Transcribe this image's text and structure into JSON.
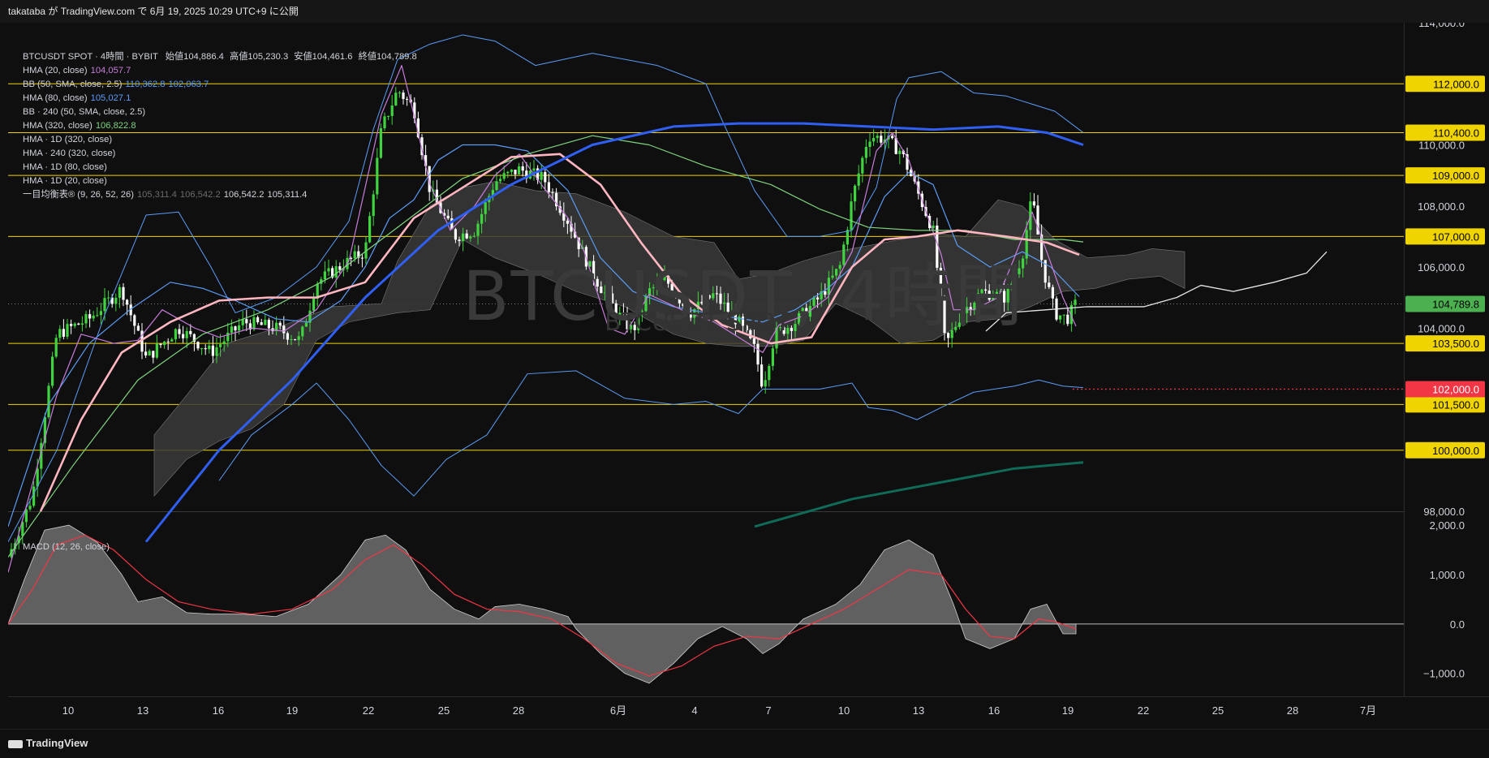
{
  "header": {
    "publish_line": "takataba が TradingView.com で 6月 19, 2025 10:29 UTC+9 に公開"
  },
  "legend": {
    "symbol_line": {
      "symbol": "BTCUSDT SPOT · 4時間 · BYBIT",
      "open_label": "始値",
      "open": "104,886.4",
      "high_label": "高値",
      "high": "105,230.3",
      "low_label": "安値",
      "low": "104,461.6",
      "close_label": "終値",
      "close": "104,789.8"
    },
    "indicators": [
      {
        "name": "HMA (20, close)",
        "values": [
          "104,057.7"
        ],
        "colors": [
          "#c77ddb"
        ]
      },
      {
        "name": "BB (50, SMA, close, 2.5)",
        "values": [
          "110,362.8",
          "102,063.7"
        ],
        "colors": [
          "#5b9cf5",
          "#5b9cf5"
        ]
      },
      {
        "name": "HMA (80, close)",
        "values": [
          "105,027.1"
        ],
        "colors": [
          "#5b9cf5"
        ]
      },
      {
        "name": "BB · 240 (50, SMA, close, 2.5)",
        "values": [],
        "colors": []
      },
      {
        "name": "HMA (320, close)",
        "values": [
          "106,822.8"
        ],
        "colors": [
          "#7fd47f"
        ]
      },
      {
        "name": "HMA · 1D (320, close)",
        "values": [],
        "colors": []
      },
      {
        "name": "HMA · 240 (320, close)",
        "values": [],
        "colors": []
      },
      {
        "name": "HMA · 1D (80, close)",
        "values": [],
        "colors": []
      },
      {
        "name": "HMA · 1D (20, close)",
        "values": [],
        "colors": []
      },
      {
        "name": "一目均衡表® (9, 26, 52, 26)",
        "values": [
          "105,311.4",
          "106,542.2",
          "106,542.2",
          "105,311.4"
        ],
        "colors": [
          "#6b6b6b",
          "#6b6b6b",
          "#d1d4dc",
          "#d1d4dc"
        ]
      }
    ]
  },
  "watermark": {
    "line1": "BTCUSDT, 4時間",
    "line2": "BTCUSDT SPOT"
  },
  "price_axis": {
    "ticks": [
      "114,000.0",
      "110,000.0",
      "108,000.0",
      "106,000.0",
      "104,000.0",
      "98,000.0"
    ],
    "levels": [
      {
        "label": "112,000.0",
        "value": 112000
      },
      {
        "label": "110,400.0",
        "value": 110400
      },
      {
        "label": "109,000.0",
        "value": 109000
      },
      {
        "label": "107,000.0",
        "value": 107000
      },
      {
        "label": "103,500.0",
        "value": 103500
      },
      {
        "label": "101,500.0",
        "value": 101500
      },
      {
        "label": "100,000.0",
        "value": 100000
      }
    ],
    "current_price": {
      "label": "104,789.8",
      "value": 104789.8,
      "color": "#26a69a"
    },
    "red_level": {
      "label": "102,000.0",
      "value": 102000,
      "color": "#f23645"
    },
    "level_color": "#f0d400"
  },
  "macd": {
    "label": "MACD (12, 26, close)",
    "ticks": [
      "2,000.0",
      "1,000.0",
      "0.0",
      "−1,000.0"
    ]
  },
  "time_axis": {
    "labels": [
      "10",
      "13",
      "16",
      "19",
      "22",
      "25",
      "28",
      "6月",
      "4",
      "7",
      "10",
      "13",
      "16",
      "19",
      "22",
      "25",
      "28",
      "7月"
    ]
  },
  "footer": {
    "brand": "TradingView"
  },
  "chart_data": {
    "type": "candlestick",
    "price_range": [
      98000,
      114000
    ],
    "macd_range": [
      -1300,
      2100
    ],
    "colors": {
      "up": "#3fd43f",
      "down": "#ffffff",
      "hma20": "#c77ddb",
      "bb": "#5b9cf5",
      "hma80": "#5b9cf5",
      "hma320": "#7fd47f",
      "hma1d": "#ffb6c1",
      "hma240_320": "#2f5ff5",
      "hma1d_320": "#0f6b57",
      "cloud": "#3a3a3a"
    }
  }
}
